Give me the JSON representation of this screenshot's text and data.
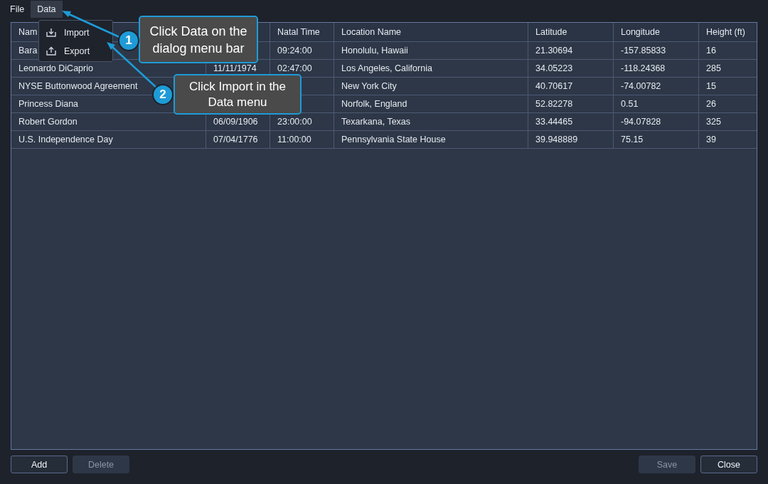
{
  "menu_bar": [
    {
      "label": "File",
      "selected": false
    },
    {
      "label": "Data",
      "selected": true
    }
  ],
  "data_menu": [
    {
      "label": "Import",
      "kind": "import"
    },
    {
      "label": "Export",
      "kind": "export"
    }
  ],
  "table": {
    "columns": [
      "Nam",
      "",
      "Natal Time",
      "Location Name",
      "Latitude",
      "Longitude",
      "Height (ft)"
    ],
    "rows": [
      [
        {
          "text": "Bara"
        },
        {},
        {
          "text": "09:24:00"
        },
        {
          "text": "Honolulu, Hawaii"
        },
        {
          "text": "21.30694"
        },
        {
          "text": "-157.85833"
        },
        {
          "text": "16"
        }
      ],
      [
        {
          "text": "Leonardo DiCaprio"
        },
        {
          "text": "11/11/1974"
        },
        {
          "text": "02:47:00"
        },
        {
          "text": "Los Angeles, California"
        },
        {
          "text": "34.05223"
        },
        {
          "text": "-118.24368"
        },
        {
          "text": "285"
        }
      ],
      [
        {
          "text": "NYSE Buttonwood Agreement"
        },
        {},
        {},
        {
          "text": "New York City"
        },
        {
          "text": "40.70617"
        },
        {
          "text": "-74.00782"
        },
        {
          "text": "15"
        }
      ],
      [
        {
          "text": "Princess Diana"
        },
        {},
        {},
        {
          "text": "Norfolk, England"
        },
        {
          "text": "52.82278"
        },
        {
          "text": "0.51"
        },
        {
          "text": "26"
        }
      ],
      [
        {
          "text": "Robert Gordon"
        },
        {
          "text": "06/09/1906"
        },
        {
          "text": "23:00:00"
        },
        {
          "text": "Texarkana, Texas"
        },
        {
          "text": "33.44465"
        },
        {
          "text": "-94.07828"
        },
        {
          "text": "325"
        }
      ],
      [
        {
          "text": "U.S. Independence Day"
        },
        {
          "text": "07/04/1776"
        },
        {
          "text": "11:00:00"
        },
        {
          "text": "Pennsylvania State House"
        },
        {
          "text": "39.948889"
        },
        {
          "text": "75.15"
        },
        {
          "text": "39"
        }
      ]
    ]
  },
  "buttons_left": [
    {
      "label": "Add",
      "disabled": false
    },
    {
      "label": "Delete",
      "disabled": true
    }
  ],
  "buttons_right": [
    {
      "label": "Save",
      "disabled": true
    },
    {
      "label": "Close",
      "disabled": false
    }
  ],
  "callouts": [
    {
      "number": "1",
      "text": "Click Data on the dialog menu bar"
    },
    {
      "number": "2",
      "text": "Click Import in the Data menu"
    }
  ]
}
